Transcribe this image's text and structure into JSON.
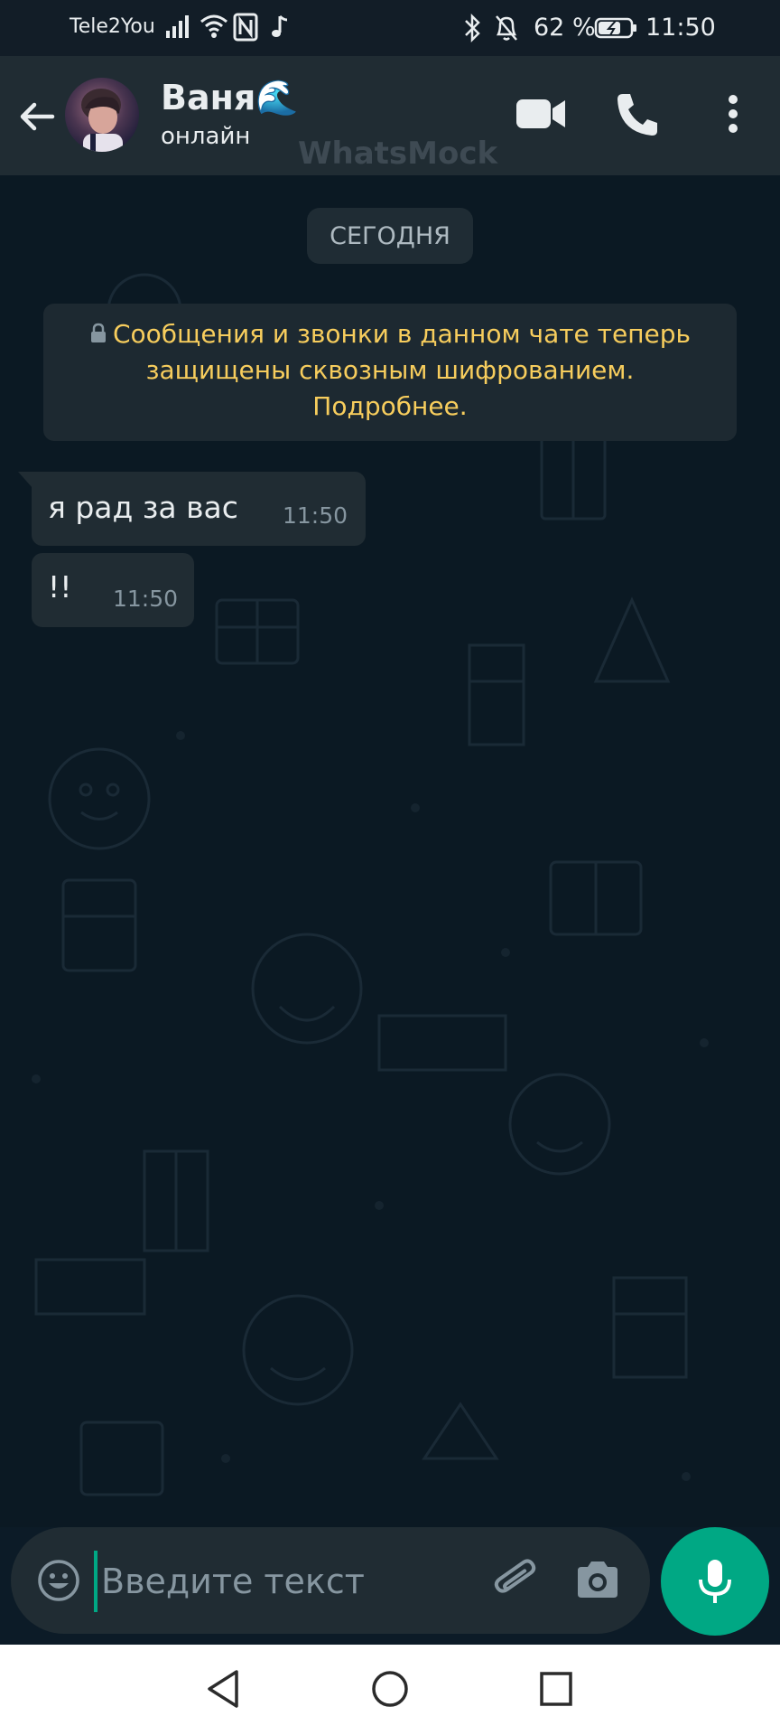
{
  "status_bar": {
    "carrier": "Tele2You",
    "battery": "62 %",
    "time": "11:50"
  },
  "header": {
    "contact_name": "Ваня🌊",
    "contact_status": "онлайн",
    "watermark": "WhatsMock"
  },
  "chat": {
    "date_label": "СЕГОДНЯ",
    "encryption_notice": "Сообщения и звонки в данном чате теперь защищены сквозным шифрованием. Подробнее.",
    "messages": [
      {
        "text": "я рад за вас",
        "time": "11:50"
      },
      {
        "text": "!!",
        "time": "11:50"
      }
    ]
  },
  "composer": {
    "placeholder": "Введите текст"
  },
  "colors": {
    "accent": "#00a884",
    "header_bg": "#202c33",
    "bubble_bg": "#202c33",
    "notice_text": "#f7cd5d"
  }
}
